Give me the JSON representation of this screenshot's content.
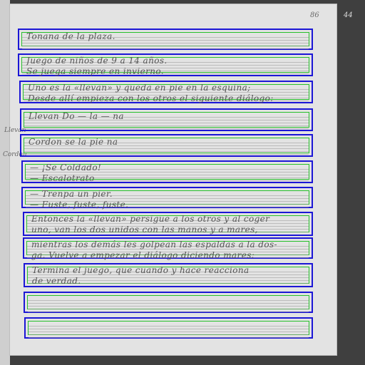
{
  "page": {
    "page_number": "86",
    "page_number_right": "44"
  },
  "margin_notes": [
    "Llevan",
    "Cordon"
  ],
  "lines": [
    {
      "id": "l1",
      "text": "Tonana de la plaza."
    },
    {
      "id": "l2",
      "text": "Juego de niños de 9 a 14 años.\nSe juega siempre en invierno."
    },
    {
      "id": "l3",
      "text": "Uno es la «llevan» y queda en pie en la esquina;\nDesde allí empieza con los otros el siguiente diálogo:"
    },
    {
      "id": "l4",
      "text": "Llevan Do — la — na"
    },
    {
      "id": "l5",
      "text": "Cordon se la pie na"
    },
    {
      "id": "l6",
      "text": "— ¡Se Coldado!\n— Escalotrato"
    },
    {
      "id": "l7",
      "text": "— Trenpa un pier.\n— Fuste, fuste, fuste."
    },
    {
      "id": "l8",
      "text": "Entonces la «llevan» persigue a los otros y al coger\nuno, van los dos unidos con las manos y a mares,"
    },
    {
      "id": "l9",
      "text": "mientras los demás les golpean las espaldas a la dos-\nga. Vuelve a empezar el diálogo diciendo mares:"
    },
    {
      "id": "l10",
      "text": "Termina el juego, que cuando y hace reacciona\nde verdad."
    },
    {
      "id": "l11",
      "text": ""
    },
    {
      "id": "l12",
      "text": ""
    }
  ]
}
